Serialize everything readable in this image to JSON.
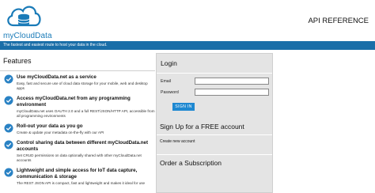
{
  "header": {
    "brand": "myCloudData",
    "api_reference": "API REFERENCE"
  },
  "tagline": "The fastest and easiest route to host your data in the cloud.",
  "features": {
    "heading": "Features",
    "items": [
      {
        "title": "Use myCloudData.net as a service",
        "desc": "Easy, fast and secure use of cloud data storage for your mobile, web and desktop apps"
      },
      {
        "title": "Access myCloudData.net from any programming environment",
        "desc": "myCloudData.net uses OAUTH 2.0 and a full REST/JSON/HTTP API, accessible from all programming environments"
      },
      {
        "title": "Roll-out your data as you go",
        "desc": "Create & update your metadata on-the-fly with our API"
      },
      {
        "title": "Control sharing data between different myCloudData.net accounts",
        "desc": "Set CRUD permissions on data optionally shared with other myCloudData.net accounts"
      },
      {
        "title": "Lightweight and simple access for IoT data capture, communication & storage",
        "desc": "The REST JSON API is compact, fast and lightweight and makes it ideal for use"
      }
    ]
  },
  "login": {
    "heading": "Login",
    "email_label": "Email",
    "email_value": "",
    "password_label": "Password",
    "password_value": "",
    "signin_label": "SIGN IN"
  },
  "signup": {
    "heading": "Sign Up for a FREE account",
    "create_link": "Create new account"
  },
  "order": {
    "heading": "Order a Subscription"
  },
  "colors": {
    "brand": "#1a7bb8",
    "tagline_bg": "#1a6ea8",
    "signin_bg": "#1e88d1",
    "panel_bg": "#e4e4e4",
    "bullet": "#2a82c4"
  }
}
